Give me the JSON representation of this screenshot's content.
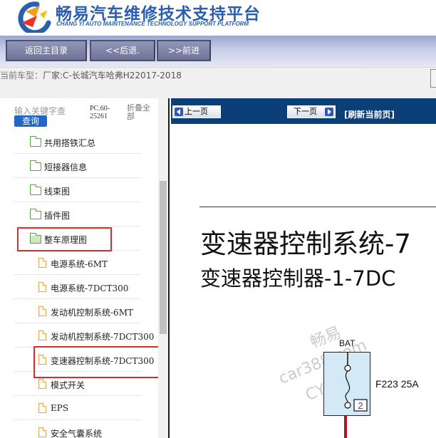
{
  "header": {
    "title_cn": "畅易汽车维修技术支持平台",
    "title_en": "CHANG YI AUTO MAINTENANCE TECHNOLOGY SUPPORT PLATFORM"
  },
  "nav": {
    "home_label": "返回主目录",
    "back_label": "<<后退.",
    "forward_label": ">>前进"
  },
  "car": {
    "label": "当前车型：",
    "value": "厂家:C-长城汽车哈弗H22017-2018"
  },
  "search": {
    "placeholder": "输入关键字查",
    "button_label": "查询",
    "code": "PC.60-25261",
    "collapse_label": "折叠全部"
  },
  "tree": {
    "items": [
      {
        "label": "共用搭铁汇总",
        "type": "folder"
      },
      {
        "label": "短接器信息",
        "type": "folder"
      },
      {
        "label": "线束图",
        "type": "folder"
      },
      {
        "label": "插件图",
        "type": "folder"
      },
      {
        "label": "整车原理图",
        "type": "folder-open",
        "highlighted": true
      },
      {
        "label": "电源系统-6MT",
        "type": "doc"
      },
      {
        "label": "电源系统-7DCT300",
        "type": "doc"
      },
      {
        "label": "发动机控制系统-6MT",
        "type": "doc"
      },
      {
        "label": "发动机控制系统-7DCT300",
        "type": "doc"
      },
      {
        "label": "变速器控制系统-7DCT300",
        "type": "doc",
        "highlighted": true
      },
      {
        "label": "模式开关",
        "type": "doc"
      },
      {
        "label": "EPS",
        "type": "doc"
      },
      {
        "label": "安全气囊系统",
        "type": "doc"
      }
    ]
  },
  "content": {
    "prev_label": "上一页",
    "next_label": "下一页",
    "refresh_label": "[刷新当前页]",
    "doc_title": "变速器控制系统-7",
    "doc_subtitle": "变速器控制器-1-7DC",
    "diagram": {
      "bat_label": "BAT",
      "fuse_code": "F223 25A",
      "pin_number": "2"
    },
    "watermark": {
      "line1": "畅易",
      "line2": "car388.com",
      "line3": "CY20165"
    }
  },
  "colors": {
    "brand_blue": "#2a5fb0",
    "toolbar_blue": "#0a3f78",
    "highlight_red": "#d62e2e",
    "folder_green": "#5aa14a",
    "doc_orange": "#e0a354",
    "wire_red": "#b3142c"
  }
}
